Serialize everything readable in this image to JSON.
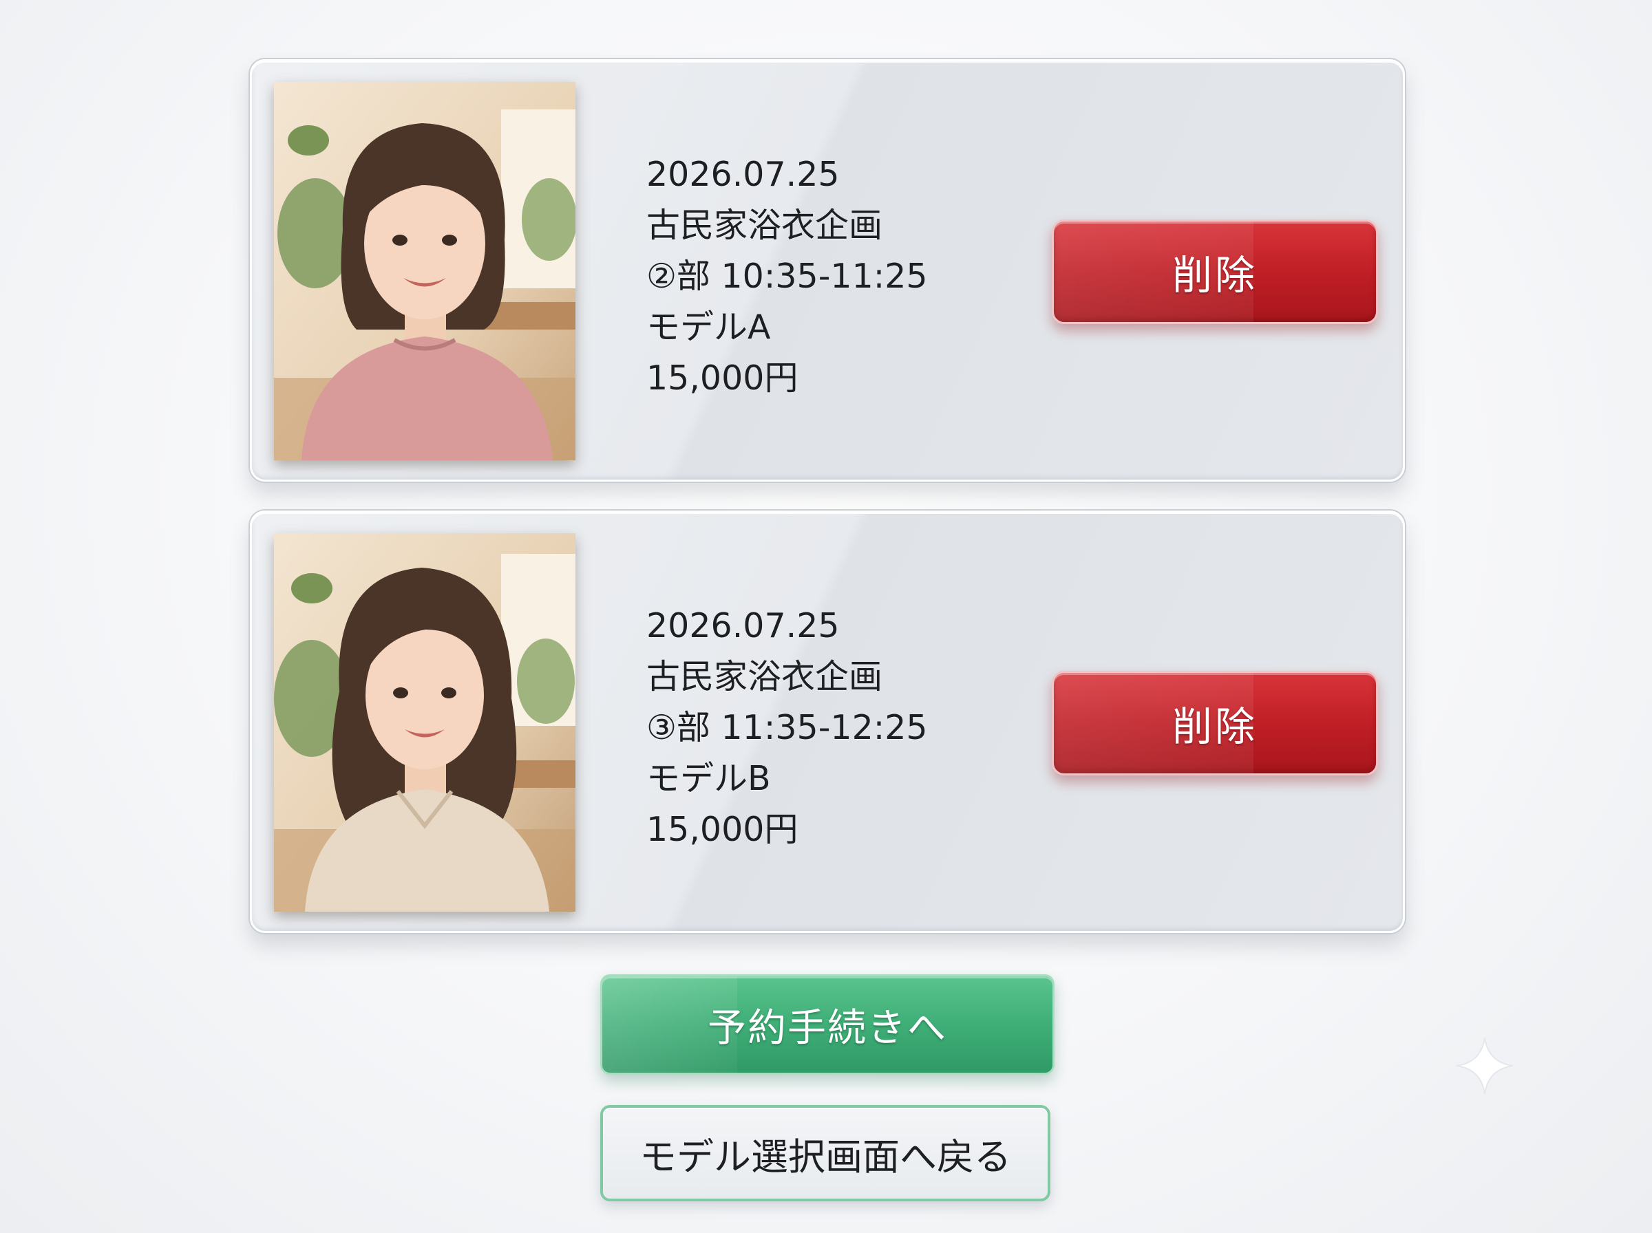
{
  "colors": {
    "delete_button": "#c01f26",
    "proceed_button": "#3fae77",
    "back_button_border": "#7fcaa2",
    "text": "#1d1f23"
  },
  "bookings": [
    {
      "photo": "model-a-photo",
      "date": "2026.07.25",
      "event": "古民家浴衣企画",
      "session": "②部 10:35-11:25",
      "model": "モデルA",
      "price": "15,000円",
      "delete_label": "削除"
    },
    {
      "photo": "model-b-photo",
      "date": "2026.07.25",
      "event": "古民家浴衣企画",
      "session": "③部 11:35-12:25",
      "model": "モデルB",
      "price": "15,000円",
      "delete_label": "削除"
    }
  ],
  "actions": {
    "proceed_label": "予約手続きへ",
    "back_label": "モデル選択画面へ戻る"
  },
  "decor": {
    "sparkle_icon": "sparkle-icon"
  }
}
